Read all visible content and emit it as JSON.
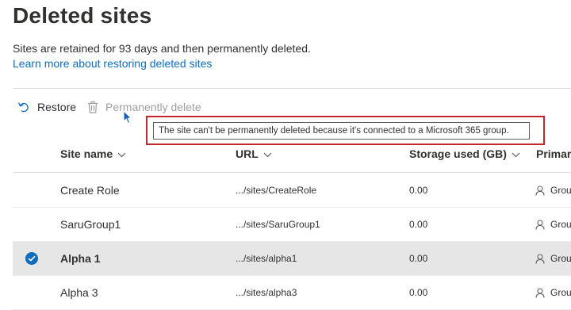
{
  "page": {
    "title": "Deleted sites",
    "description": "Sites are retained for 93 days and then permanently deleted.",
    "learn_more_link": "Learn more about restoring deleted sites"
  },
  "toolbar": {
    "restore_label": "Restore",
    "restore_icon": "restore-arrow-icon",
    "permanently_delete_label": "Permanently delete",
    "permanently_delete_icon": "trash-icon",
    "permanently_delete_enabled": false
  },
  "tooltip": {
    "text": "The site can't be permanently deleted because it's connected to a Microsoft 365 group.",
    "highlight_color": "#c4262e"
  },
  "table": {
    "columns": [
      {
        "label": "Site name",
        "sortable": true
      },
      {
        "label": "URL",
        "sortable": true
      },
      {
        "label": "Storage used (GB)",
        "sortable": true
      },
      {
        "label": "Primary",
        "sortable": false
      }
    ],
    "rows": [
      {
        "name": "Create Role",
        "url": ".../sites/CreateRole",
        "storage": "0.00",
        "primary": "Group",
        "selected": false
      },
      {
        "name": "SaruGroup1",
        "url": ".../sites/SaruGroup1",
        "storage": "0.00",
        "primary": "Group",
        "selected": false
      },
      {
        "name": "Alpha 1",
        "url": ".../sites/alpha1",
        "storage": "0.00",
        "primary": "Group",
        "selected": true
      },
      {
        "name": "Alpha 3",
        "url": ".../sites/alpha3",
        "storage": "0.00",
        "primary": "Group",
        "selected": false
      }
    ]
  },
  "colors": {
    "accent": "#0f6cbd",
    "selected_row": "#e6e6e6",
    "disabled_text": "#a19f9d"
  }
}
